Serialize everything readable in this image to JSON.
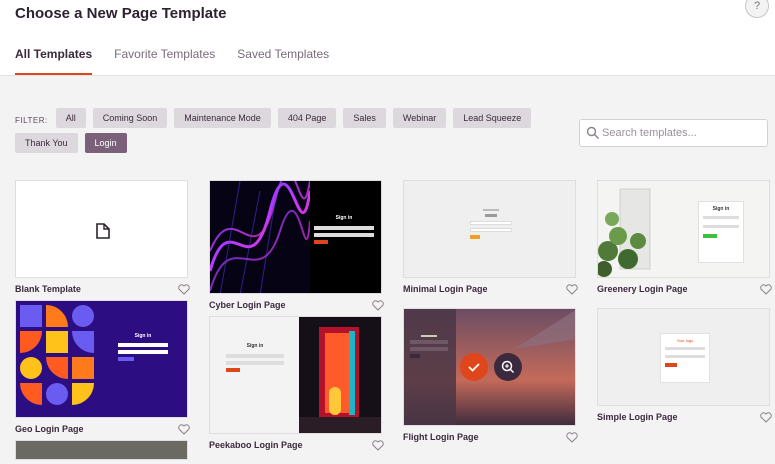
{
  "header": {
    "title": "Choose a New Page Template",
    "help_icon": "help-circle-icon",
    "tabs": [
      {
        "label": "All Templates"
      },
      {
        "label": "Favorite Templates"
      },
      {
        "label": "Saved Templates"
      }
    ]
  },
  "filter": {
    "label": "FILTER:",
    "chips": [
      "All",
      "Coming Soon",
      "Maintenance Mode",
      "404 Page",
      "Sales",
      "Webinar",
      "Lead Squeeze",
      "Thank You",
      "Login"
    ],
    "active": "Login"
  },
  "search": {
    "placeholder": "Search templates..."
  },
  "templates": {
    "blank": {
      "title": "Blank Template"
    },
    "cyber": {
      "title": "Cyber Login Page",
      "heading": "Sign in"
    },
    "minimal": {
      "title": "Minimal Login Page"
    },
    "greenery": {
      "title": "Greenery Login Page",
      "heading": "Sign in"
    },
    "geo": {
      "title": "Geo Login Page",
      "heading": "Sign in"
    },
    "peekaboo": {
      "title": "Peekaboo Login Page",
      "heading": "Sign in"
    },
    "flight": {
      "title": "Flight Login Page"
    },
    "simple": {
      "title": "Simple Login Page",
      "heading": "Your logo"
    }
  },
  "colors": {
    "accent": "#e0461c",
    "chip_active": "#7a6079",
    "chip": "#ddd8dd"
  }
}
